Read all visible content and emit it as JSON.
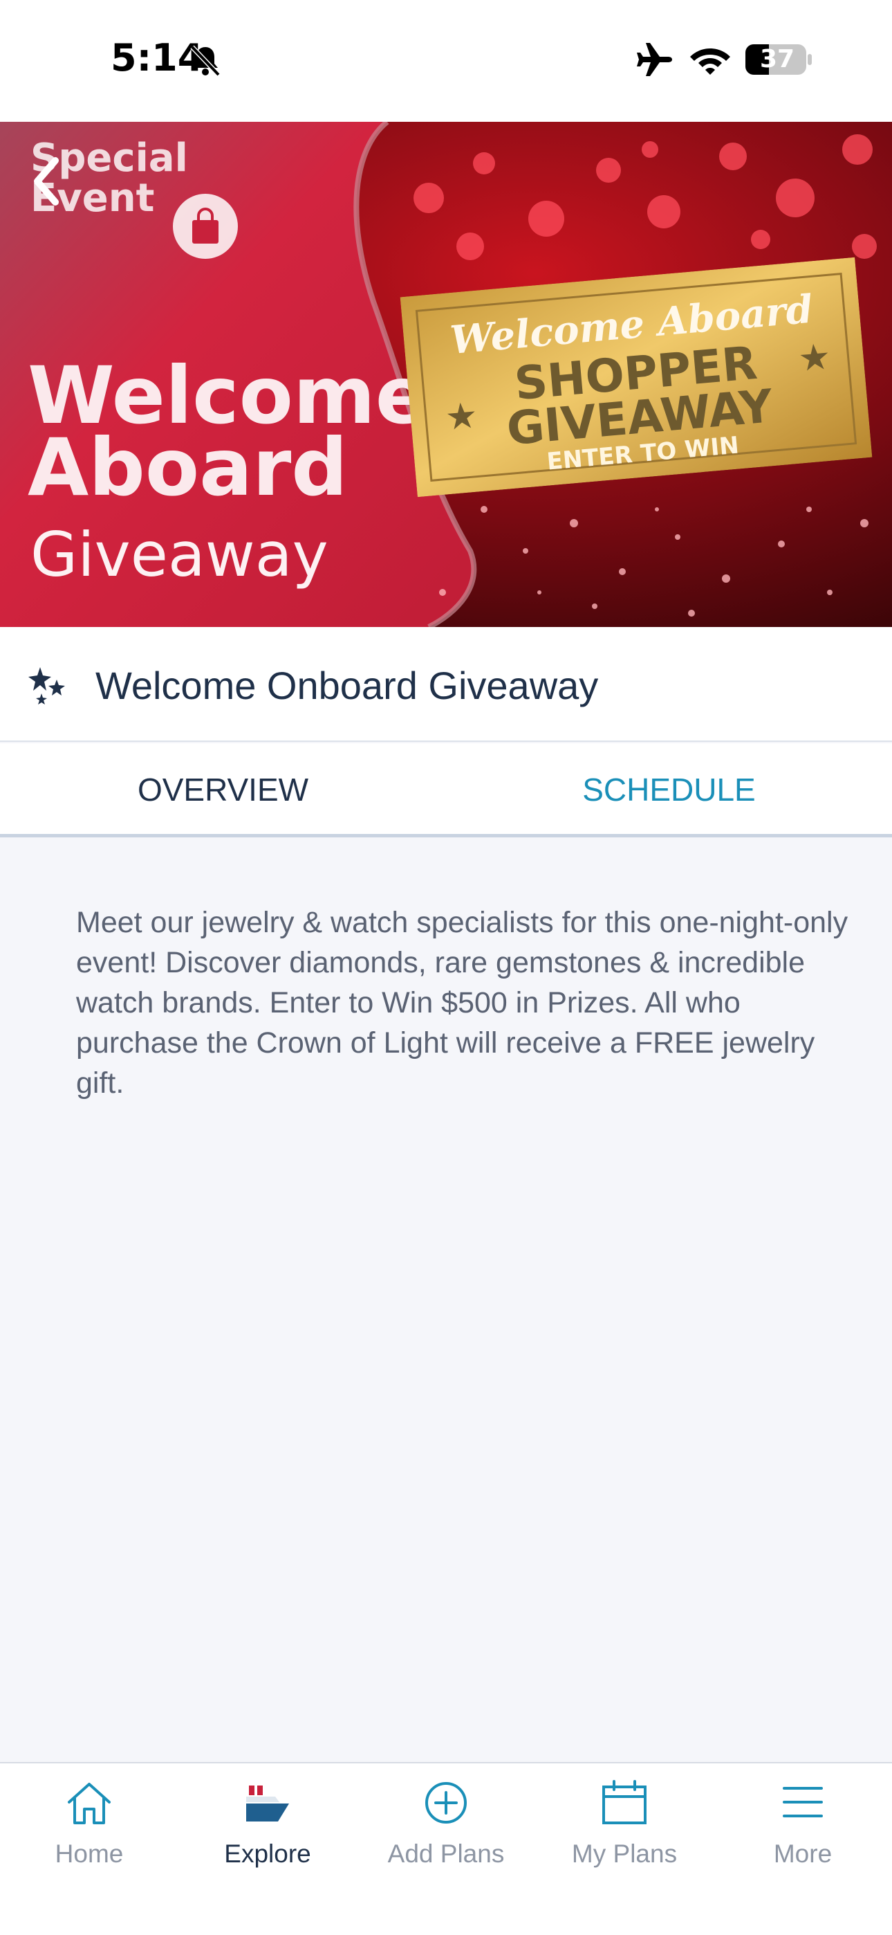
{
  "status_bar": {
    "time": "5:14",
    "battery": "37",
    "icons": [
      "bell-muted-icon",
      "airplane-icon",
      "wifi-icon",
      "battery-icon"
    ]
  },
  "hero": {
    "badge_line1": "Special",
    "badge_line2": "Event",
    "title_line1": "Welcome",
    "title_line2": "Aboard",
    "subtitle": "Giveaway",
    "ticket_script": "Welcome Aboard",
    "ticket_line1": "SHOPPER",
    "ticket_line2": "GIVEAWAY",
    "ticket_cta": "ENTER TO WIN",
    "colors": {
      "red": "#c8213b",
      "gold": "#d6a648"
    }
  },
  "event": {
    "title": "Welcome Onboard Giveaway",
    "icon": "sparkle-stars-icon"
  },
  "tabs": [
    {
      "label": "OVERVIEW",
      "active": true
    },
    {
      "label": "SCHEDULE",
      "active": false
    }
  ],
  "description": "Meet our jewelry & watch specialists for this one-night-only event! Discover diamonds, rare gemstones & incredible watch brands. Enter to Win $500 in Prizes. All who purchase the Crown of Light will receive a FREE jewelry gift.",
  "nav": [
    {
      "label": "Home",
      "icon": "home-icon",
      "active": false
    },
    {
      "label": "Explore",
      "icon": "ship-icon",
      "active": true
    },
    {
      "label": "Add Plans",
      "icon": "plus-circle-icon",
      "active": false
    },
    {
      "label": "My Plans",
      "icon": "calendar-icon",
      "active": false
    },
    {
      "label": "More",
      "icon": "menu-icon",
      "active": false
    }
  ],
  "colors": {
    "accent": "#1a8fb8",
    "navy": "#1f3049",
    "muted": "#8d95a3",
    "background": "#f5f6fa"
  }
}
